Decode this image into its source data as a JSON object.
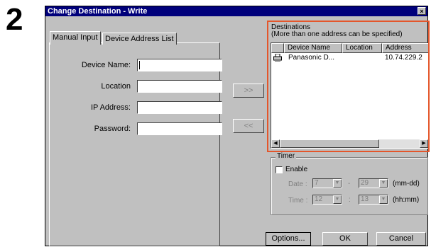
{
  "step_number": "2",
  "window": {
    "title": "Change Destination - Write",
    "close_glyph": "×"
  },
  "tabs": [
    {
      "label": "Manual Input",
      "active": true
    },
    {
      "label": "Device Address List",
      "active": false
    }
  ],
  "manual_input": {
    "fields": [
      {
        "label": "Device Name:",
        "value": ""
      },
      {
        "label": "Location",
        "value": ""
      },
      {
        "label": "IP Address:",
        "value": ""
      },
      {
        "label": "Password:",
        "value": ""
      }
    ]
  },
  "transfer_buttons": {
    "add_label": ">>",
    "remove_label": "<<"
  },
  "destinations": {
    "title_line1": "Destinations",
    "title_line2": "(More than one address can be specified)",
    "columns": [
      "Device Name",
      "Location",
      "Address"
    ],
    "rows": [
      {
        "icon": "printer-icon",
        "device_name": "Panasonic D...",
        "location": "",
        "address": "10.74.229.2"
      }
    ],
    "scroll_left_glyph": "◀",
    "scroll_right_glyph": "▶"
  },
  "timer": {
    "group_label": "Timer",
    "enable_label": "Enable",
    "enable_checked": false,
    "date_label": "Date :",
    "date_month": "7",
    "date_day": "29",
    "date_dash": "-",
    "date_format": "(mm-dd)",
    "time_label": "Time :",
    "time_hour": "12",
    "time_minute": "13",
    "time_colon": ":",
    "time_format": "(hh:mm)",
    "spin_glyph": "▼"
  },
  "footer": {
    "options_label": "Options...",
    "ok_label": "OK",
    "cancel_label": "Cancel"
  },
  "colors": {
    "titlebar": "#00007b",
    "highlight_box": "#e4562b",
    "dialog_bg": "#c0c0c0"
  }
}
